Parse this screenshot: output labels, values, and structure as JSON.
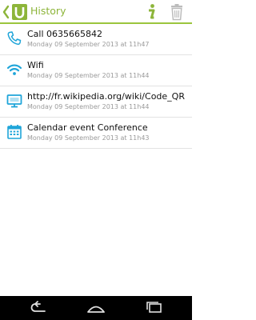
{
  "header": {
    "title": "History",
    "app_icon": "qr-app-logo-icon",
    "back_icon": "chevron-left-icon",
    "actions": [
      {
        "icon": "info-icon"
      },
      {
        "icon": "trash-icon"
      }
    ]
  },
  "history": {
    "items": [
      {
        "icon": "phone-icon",
        "title": "Call 0635665842",
        "timestamp": "Monday 09 September 2013 at 11h47"
      },
      {
        "icon": "wifi-icon",
        "title": "Wifi",
        "timestamp": "Monday 09 September 2013 at 11h44"
      },
      {
        "icon": "monitor-icon",
        "title": "http://fr.wikipedia.org/wiki/Code_QR",
        "timestamp": "Monday 09 September 2013 at 11h44"
      },
      {
        "icon": "calendar-icon",
        "title": "Calendar event Conference",
        "timestamp": "Monday 09 September 2013 at 11h43"
      }
    ]
  },
  "system_nav": {
    "buttons": [
      "back-icon",
      "home-icon",
      "recent-apps-icon"
    ]
  },
  "colors": {
    "accent_green": "#8db53a",
    "icon_blue": "#1fa5d9",
    "nav_bar": "#000000"
  }
}
